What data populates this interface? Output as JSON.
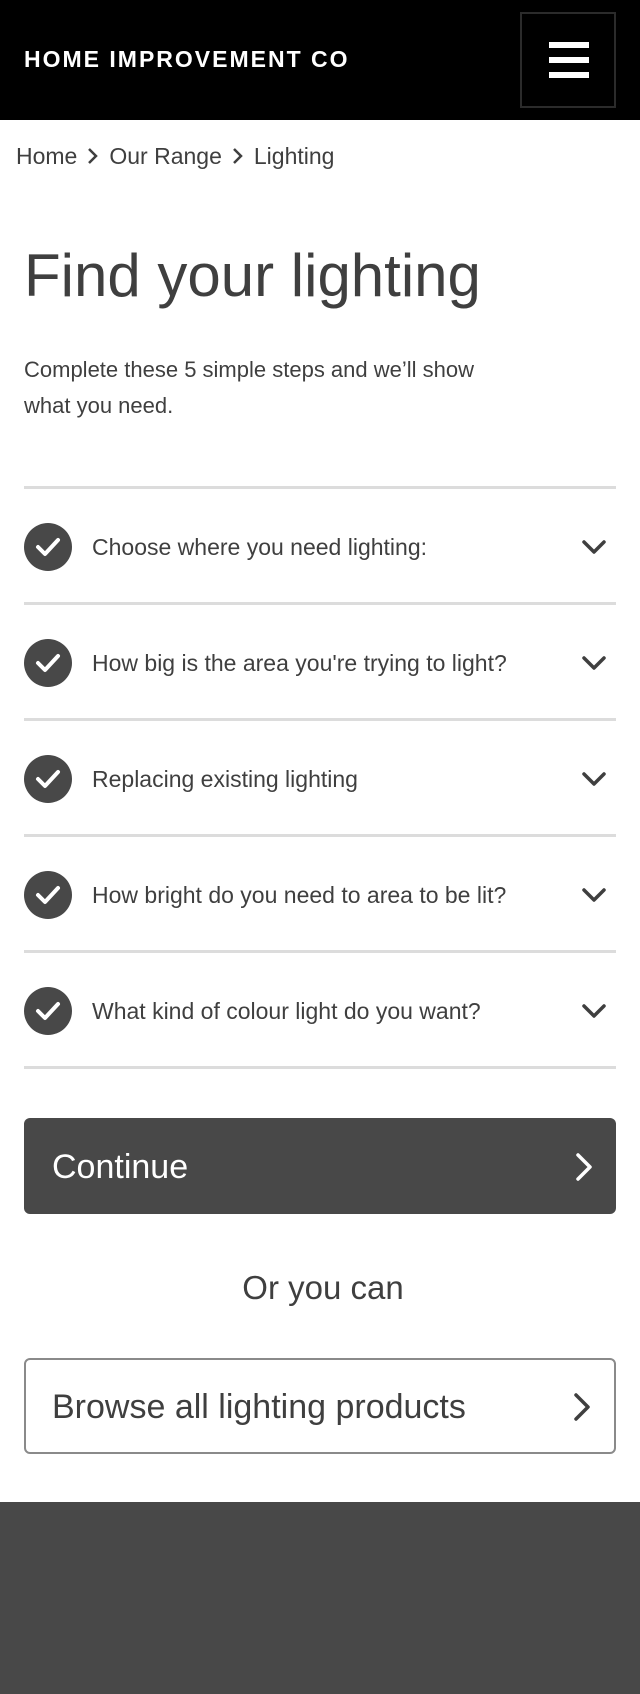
{
  "header": {
    "brand": "HOME IMPROVEMENT CO",
    "menu_icon": "hamburger-menu-icon",
    "background": "#000000"
  },
  "breadcrumb": {
    "items": [
      "Home",
      "Our Range",
      "Lighting"
    ],
    "separator_icon": "chevron-right-icon"
  },
  "main": {
    "title": "Find your lighting",
    "intro": "Complete these 5 simple steps and we’ll show what you need.",
    "steps": [
      {
        "label": "Choose where you need lighting:",
        "status": "complete"
      },
      {
        "label": "How big is the area you're trying to light?",
        "status": "complete"
      },
      {
        "label": "Replacing existing lighting",
        "status": "complete"
      },
      {
        "label": "How bright do you need to area to be lit?",
        "status": "complete"
      },
      {
        "label": "What kind of colour light do you want?",
        "status": "complete"
      }
    ],
    "step_icon": "check-circle-icon",
    "expand_icon": "chevron-down-icon",
    "continue_label": "Continue",
    "or_text": "Or you can",
    "browse_label": "Browse all lighting products"
  },
  "colors": {
    "primary": "#484848",
    "text": "#3f3f3f",
    "divider": "#dcdcdc",
    "header": "#000000",
    "footer": "#484848"
  }
}
